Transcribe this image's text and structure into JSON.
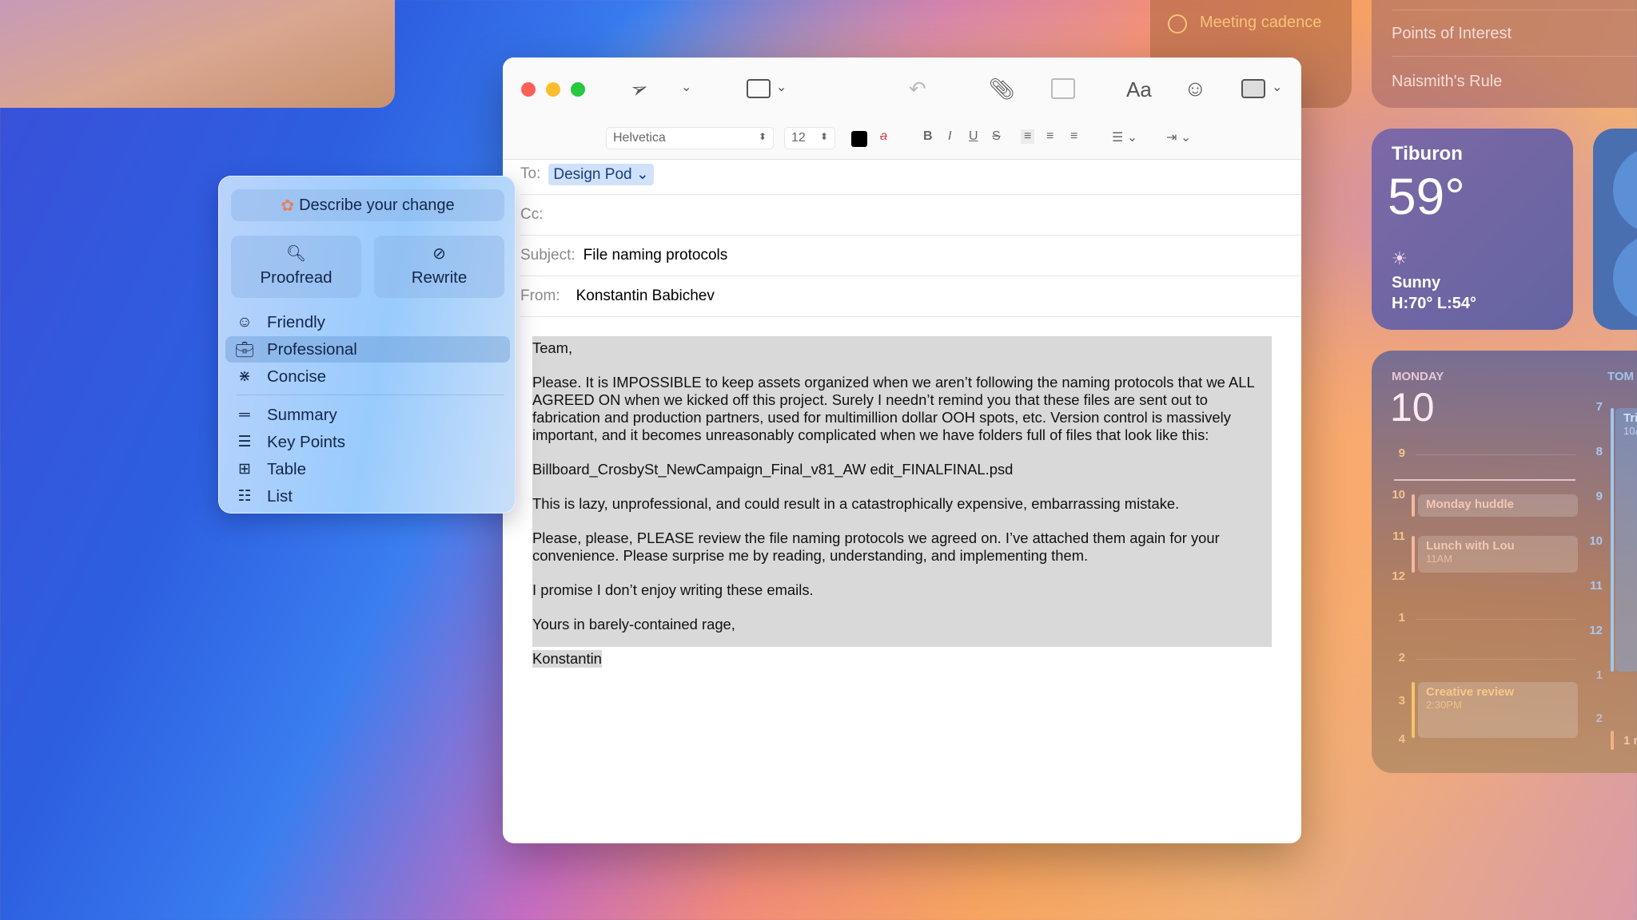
{
  "widgets": {
    "reminder": {
      "label": "Meeting cadence",
      "accent": "#f7c27a"
    },
    "notes": {
      "items": [
        "Points of Interest",
        "Naismith's Rule"
      ]
    },
    "weather": {
      "city": "Tiburon",
      "temp": "59°",
      "condition": "Sunny",
      "range": "H:70° L:54°",
      "icon": "sun-icon"
    },
    "calendar": {
      "day": "MONDAY",
      "date": "10",
      "hours": [
        "9",
        "10",
        "11",
        "12",
        "1",
        "2",
        "3",
        "4"
      ],
      "events": [
        {
          "title": "Monday huddle",
          "time": ""
        },
        {
          "title": "Lunch with Lou",
          "time": "11AM"
        },
        {
          "title": "Creative review",
          "time": "2:30PM"
        }
      ],
      "tomorrow": {
        "label": "TOM",
        "hours": [
          "7",
          "8",
          "9",
          "10",
          "11",
          "12",
          "1",
          "2"
        ],
        "event_title": "Tri",
        "event_time": "10A",
        "more": "1 m"
      }
    }
  },
  "mail": {
    "toolbar": {
      "icons": [
        "send-icon",
        "chevron-down-icon",
        "header-fields-icon",
        "reply-icon",
        "attachment-icon",
        "markup-icon",
        "fonts-icon",
        "emoji-icon",
        "photo-browser-icon"
      ],
      "fonts_label": "Aa"
    },
    "format": {
      "font": "Helvetica",
      "size": "12",
      "text_color": "#000000"
    },
    "to_label": "To:",
    "to": "Design Pod",
    "cc_label": "Cc:",
    "subject_label": "Subject:",
    "subject": "File naming protocols",
    "from_label": "From:",
    "from": "Konstantin Babichev",
    "body": [
      "Team,",
      "Please. It is IMPOSSIBLE to keep assets organized when we aren’t following the naming protocols that we ALL AGREED ON when we kicked off this project. Surely I needn’t remind you that these files are sent out to fabrication and production partners, used for multimillion dollar OOH spots, etc. Version control is massively important, and it becomes unreasonably complicated when we have folders full of files that look like this:",
      "Billboard_CrosbySt_NewCampaign_Final_v81_AW edit_FINALFINAL.psd",
      "This is lazy, unprofessional, and could result in a catastrophically expensive, embarrassing mistake.",
      "Please, please, PLEASE review the file naming protocols we agreed on. I’ve attached them again for your convenience. Please surprise me by reading, understanding, and implementing them.",
      "I promise I don’t enjoy writing these emails.",
      "Yours in barely-contained rage,",
      "Konstantin"
    ]
  },
  "writing_tools": {
    "describe": "Describe your change",
    "proofread": "Proofread",
    "rewrite": "Rewrite",
    "tones": [
      {
        "label": "Friendly",
        "icon": "smiley-icon"
      },
      {
        "label": "Professional",
        "icon": "briefcase-icon",
        "selected": true
      },
      {
        "label": "Concise",
        "icon": "compress-icon"
      }
    ],
    "formats": [
      {
        "label": "Summary",
        "icon": "summary-icon"
      },
      {
        "label": "Key Points",
        "icon": "key-points-icon"
      },
      {
        "label": "Table",
        "icon": "table-icon"
      },
      {
        "label": "List",
        "icon": "list-icon"
      }
    ]
  }
}
